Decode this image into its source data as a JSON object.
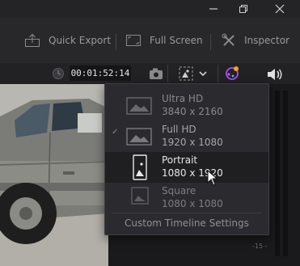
{
  "toolbar": {
    "quick_export": "Quick Export",
    "full_screen": "Full Screen",
    "inspector": "Inspector"
  },
  "viewer": {
    "timecode": "00:01:52:14"
  },
  "meter": {
    "label": "-15 -"
  },
  "resolution_menu": {
    "items": [
      {
        "title": "Ultra HD",
        "size": "3840 x 2160",
        "checked": false,
        "hovered": false
      },
      {
        "title": "Full HD",
        "size": "1920 x 1080",
        "checked": true,
        "hovered": false
      },
      {
        "title": "Portrait",
        "size": "1080 x 1920",
        "checked": false,
        "hovered": true
      },
      {
        "title": "Square",
        "size": "1080 x 1080",
        "checked": false,
        "hovered": false
      }
    ],
    "custom": "Custom Timeline Settings"
  },
  "colors": {
    "accent_purple": "#c050ff",
    "menu_bg": "#2b2b2f",
    "toolbar_bg": "#28282b"
  }
}
